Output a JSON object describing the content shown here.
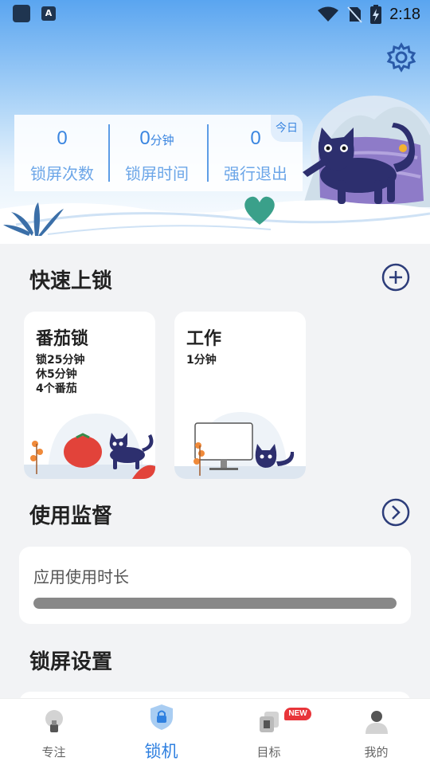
{
  "status_bar": {
    "time": "2:18",
    "icons": [
      "app-icon",
      "a-app-icon",
      "wifi-icon",
      "no-sim-icon",
      "battery-charging-icon"
    ]
  },
  "header": {
    "settings_icon": "gear-icon",
    "today_tag": "今日",
    "stats": [
      {
        "value": "0",
        "unit": "",
        "label": "锁屏次数"
      },
      {
        "value": "0",
        "unit": "分钟",
        "label": "锁屏时间"
      },
      {
        "value": "0",
        "unit": "",
        "label": "强行退出"
      }
    ]
  },
  "quick_lock": {
    "title": "快速上锁",
    "add_icon": "plus-circle-icon",
    "cards": [
      {
        "title": "番茄锁",
        "details": [
          "锁25分钟",
          "休5分钟",
          "4个番茄"
        ]
      },
      {
        "title": "工作",
        "details": [
          "1分钟"
        ]
      }
    ]
  },
  "usage_monitor": {
    "title": "使用监督",
    "arrow_icon": "chevron-right-circle-icon",
    "card_label": "应用使用时长",
    "progress": 1.0
  },
  "lock_settings": {
    "title": "锁屏设置"
  },
  "bottom_nav": {
    "items": [
      {
        "label": "专注",
        "icon": "lightbulb-icon",
        "active": false
      },
      {
        "label": "锁机",
        "icon": "shield-lock-icon",
        "active": true
      },
      {
        "label": "目标",
        "icon": "target-cards-icon",
        "active": false
      },
      {
        "label": "我的",
        "icon": "person-icon",
        "active": false
      }
    ],
    "badge": "NEW"
  },
  "colors": {
    "accent": "#2f80e0",
    "stat_blue": "#3b86e0",
    "nav_badge": "#e8353a",
    "cat": "#2d2f6e"
  }
}
